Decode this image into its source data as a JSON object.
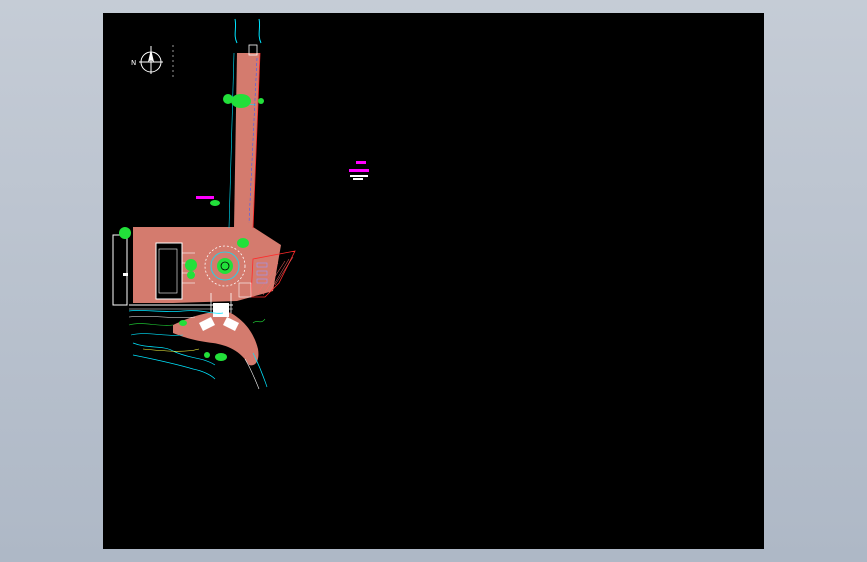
{
  "canvas": {
    "background": "#000000",
    "frame_background": "#b6bfcc"
  },
  "colors": {
    "paving": "#d47b6e",
    "paving_dark": "#c06a5e",
    "vegetation": "#22e03a",
    "magenta": "#ff00ff",
    "cyan": "#00e5ff",
    "white": "#ffffff",
    "red": "#ff2a2a",
    "yellow": "#ffff40",
    "blue": "#3a5cff"
  },
  "compass": {
    "north_label": "N"
  },
  "labels": {
    "magenta_text": "",
    "white_text": ""
  }
}
